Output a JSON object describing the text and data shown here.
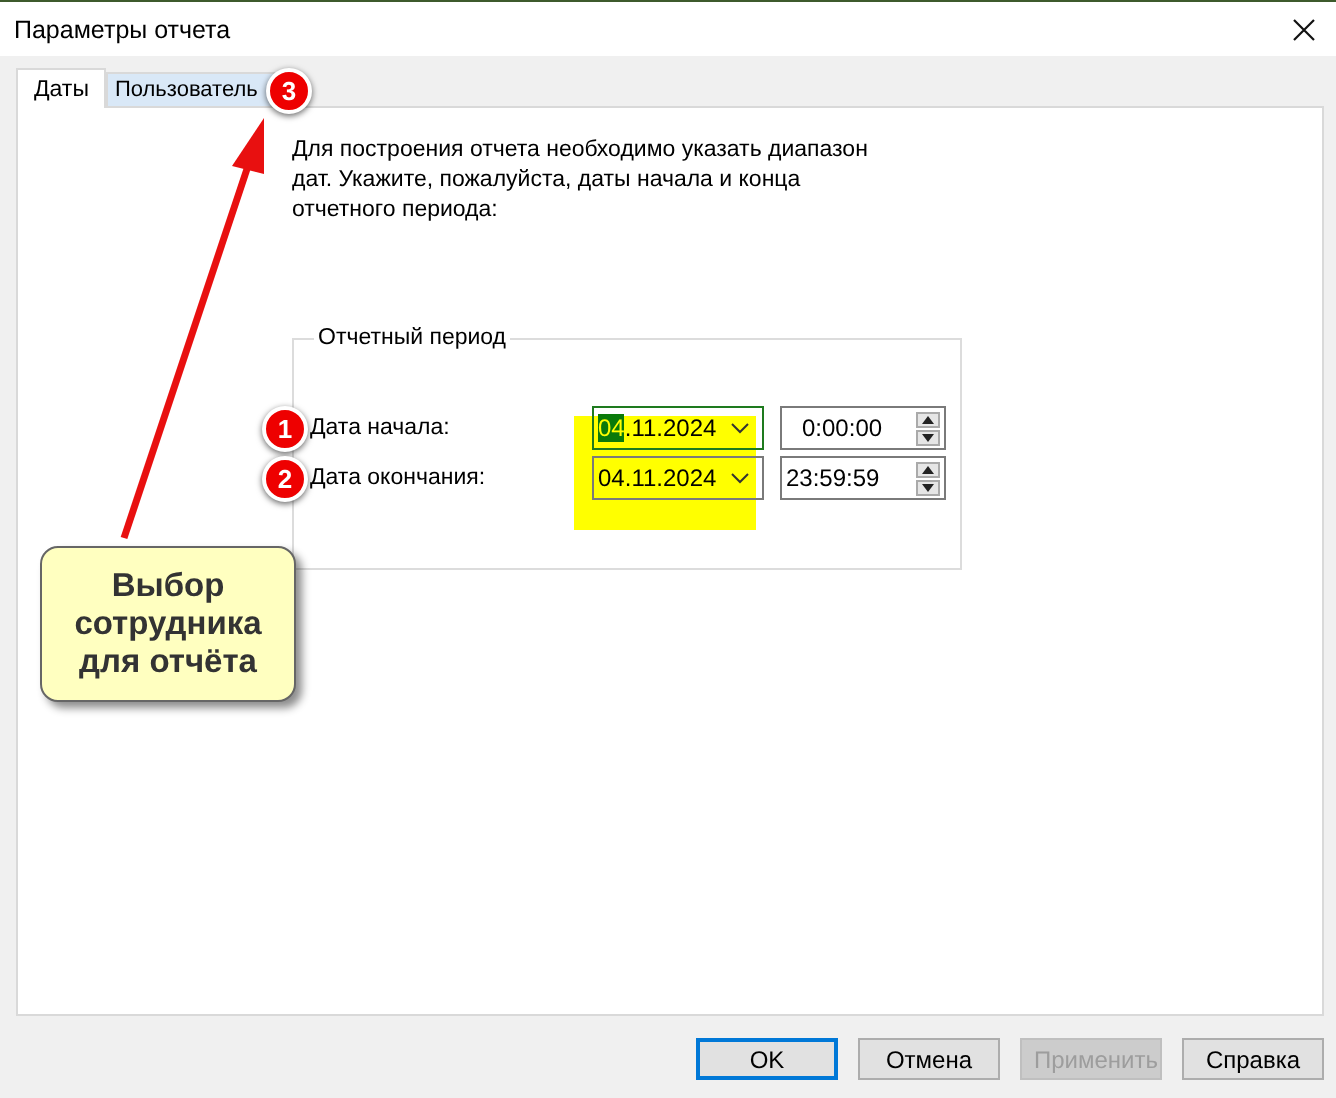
{
  "window": {
    "title": "Параметры отчета"
  },
  "tabs": [
    {
      "label": "Даты",
      "selected": true
    },
    {
      "label": "Пользователь",
      "selected": false
    }
  ],
  "description": "Для построения отчета необходимо указать диапазон дат. Укажите, пожалуйста, даты начала и конца отчетного периода:",
  "group": {
    "title": "Отчетный период",
    "rows": [
      {
        "badge": "1",
        "label": "Дата начала:",
        "date": "04.11.2024",
        "day_selected": true,
        "focused": true,
        "time": "0:00:00"
      },
      {
        "badge": "2",
        "label": "Дата окончания:",
        "date": "04.11.2024",
        "day_selected": false,
        "focused": false,
        "time": "23:59:59"
      }
    ]
  },
  "tab_badge": "3",
  "callout": "Выбор сотрудника для отчёта",
  "buttons": [
    {
      "label": "OK",
      "default": true,
      "disabled": false
    },
    {
      "label": "Отмена",
      "default": false,
      "disabled": false
    },
    {
      "label": "Применить",
      "default": false,
      "disabled": true
    },
    {
      "label": "Справка",
      "default": false,
      "disabled": false
    }
  ]
}
